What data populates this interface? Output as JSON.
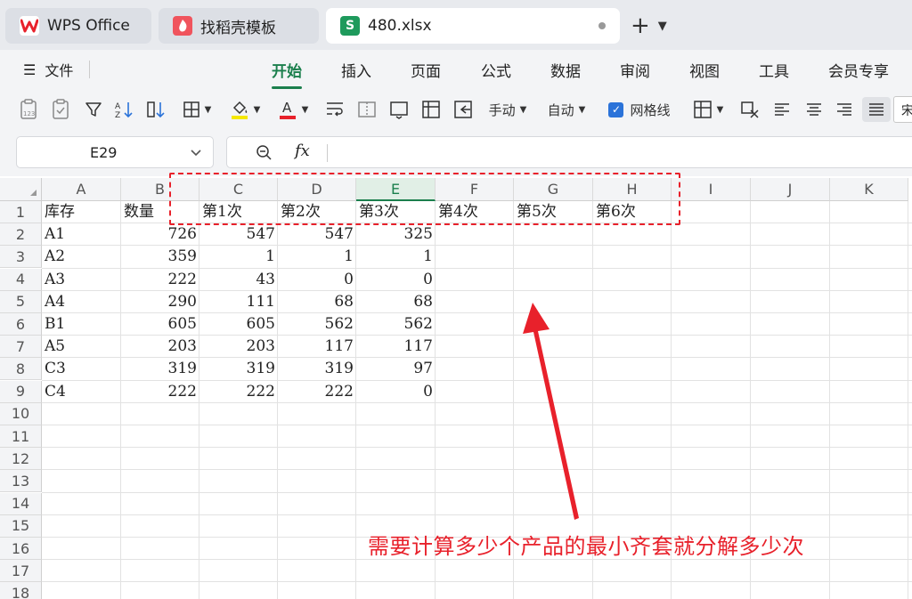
{
  "tabs": [
    {
      "label": "WPS Office",
      "icon": "wps-logo-icon",
      "active": false
    },
    {
      "label": "找稻壳模板",
      "icon": "docer-icon",
      "active": false
    },
    {
      "label": "480.xlsx",
      "icon": "sheet-icon",
      "active": true
    }
  ],
  "menu": {
    "file": "文件",
    "items": [
      "开始",
      "插入",
      "页面",
      "公式",
      "数据",
      "审阅",
      "视图",
      "工具",
      "会员专享"
    ],
    "active": "开始"
  },
  "toolbar": {
    "row_height_mode": "手动",
    "col_width_mode": "自动",
    "gridlines_label": "网格线",
    "gridlines_checked": true,
    "font_partial": "宋",
    "fill_color": "#f5e800",
    "font_color": "#e8212b"
  },
  "formula": {
    "name_box": "E29",
    "fx_label": "fx",
    "value": ""
  },
  "grid": {
    "columns": [
      "A",
      "B",
      "C",
      "D",
      "E",
      "F",
      "G",
      "H",
      "I",
      "J",
      "K"
    ],
    "selected_column": "E",
    "row_numbers": [
      "1",
      "2",
      "3",
      "4",
      "5",
      "6",
      "7",
      "8",
      "9",
      "10",
      "11",
      "12",
      "13",
      "14",
      "15",
      "16",
      "17",
      "18"
    ],
    "header_row": [
      "库存",
      "数量",
      "第1次",
      "第2次",
      "第3次",
      "第4次",
      "第5次",
      "第6次"
    ],
    "rows": [
      [
        "A1",
        "726",
        "547",
        "547",
        "325"
      ],
      [
        "A2",
        "359",
        "1",
        "1",
        "1"
      ],
      [
        "A3",
        "222",
        "43",
        "0",
        "0"
      ],
      [
        "A4",
        "290",
        "111",
        "68",
        "68"
      ],
      [
        "B1",
        "605",
        "605",
        "562",
        "562"
      ],
      [
        "A5",
        "203",
        "203",
        "117",
        "117"
      ],
      [
        "C3",
        "319",
        "319",
        "319",
        "97"
      ],
      [
        "C4",
        "222",
        "222",
        "222",
        "0"
      ]
    ]
  },
  "annotation": {
    "text": "需要计算多少个产品的最小齐套就分解多少次",
    "color": "#e8212b"
  }
}
